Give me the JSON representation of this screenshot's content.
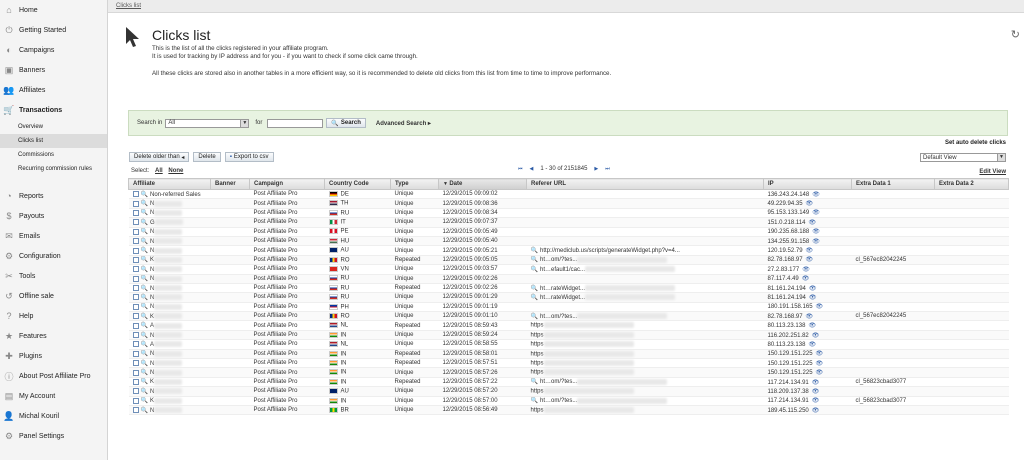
{
  "sidebar": {
    "items": [
      {
        "label": "Home",
        "icon": "home-icon",
        "glyph": "⌂"
      },
      {
        "label": "Getting Started",
        "icon": "power-icon",
        "glyph": "⏻"
      },
      {
        "label": "Campaigns",
        "icon": "campaigns-icon",
        "glyph": "◐"
      },
      {
        "label": "Banners",
        "icon": "banners-icon",
        "glyph": "▣"
      },
      {
        "label": "Affiliates",
        "icon": "affiliates-icon",
        "glyph": "👥"
      },
      {
        "label": "Transactions",
        "icon": "cart-icon",
        "glyph": "🛒"
      }
    ],
    "subitems": [
      {
        "label": "Overview"
      },
      {
        "label": "Clicks list"
      },
      {
        "label": "Commissions"
      },
      {
        "label": "Recurring commission rules"
      }
    ],
    "items2": [
      {
        "label": "Reports",
        "icon": "reports-icon",
        "glyph": "◔"
      },
      {
        "label": "Payouts",
        "icon": "payouts-icon",
        "glyph": "$"
      },
      {
        "label": "Emails",
        "icon": "email-icon",
        "glyph": "✉"
      },
      {
        "label": "Configuration",
        "icon": "gear-icon",
        "glyph": "⚙"
      },
      {
        "label": "Tools",
        "icon": "tools-icon",
        "glyph": "✂"
      },
      {
        "label": "Offline sale",
        "icon": "offline-sale-icon",
        "glyph": "↺"
      },
      {
        "label": "Help",
        "icon": "help-icon",
        "glyph": "?"
      },
      {
        "label": "Features",
        "icon": "star-icon",
        "glyph": "★"
      },
      {
        "label": "Plugins",
        "icon": "plugins-icon",
        "glyph": "✚"
      },
      {
        "label": "About Post Affiliate Pro",
        "icon": "info-icon",
        "glyph": "ⓘ"
      },
      {
        "label": "My Account",
        "icon": "account-icon",
        "glyph": "▤"
      },
      {
        "label": "Michal Kouril",
        "icon": "user-icon",
        "glyph": "👤"
      },
      {
        "label": "Panel Settings",
        "icon": "settings-icon",
        "glyph": "⚙"
      }
    ]
  },
  "breadcrumb": "Clicks list",
  "header": {
    "title": "Clicks list",
    "line1": "This is the list of all the clicks registered in your affiliate program.",
    "line2": "It is used for tracking by IP address and for you - if you want to check if some click came through.",
    "line3": "All these clicks are stored also in another tables in a more efficient way, so it is recommended to delete old clicks from this list from time to time to improve performance."
  },
  "search": {
    "label": "Search in",
    "scope": "All",
    "for_label": "for",
    "query": "",
    "button": "Search",
    "advanced": "Advanced Search"
  },
  "auto_delete": "Set auto delete clicks",
  "actions": {
    "delete_older": "Delete older than",
    "delete": "Delete",
    "export": "Export to csv"
  },
  "view": {
    "selected": "Default View",
    "edit": "Edit View"
  },
  "select": {
    "label": "Select:",
    "all": "All",
    "none": "None"
  },
  "pager": {
    "text": "1 - 30 of 2151845",
    "first": "⏮",
    "prev": "◀",
    "next": "▶",
    "last": "⏭"
  },
  "columns": [
    "Affiliate",
    "Banner",
    "Campaign",
    "Country Code",
    "Type",
    "Date",
    "Referer URL",
    "IP",
    "Extra Data 1",
    "Extra Data 2"
  ],
  "rows": [
    {
      "aff": "Non-referred Sales",
      "campaign": "Post Affiliate Pro",
      "cc": "DE",
      "flag": [
        "#000",
        "#d00",
        "#fc0"
      ],
      "type": "Unique",
      "date": "12/29/2015 09:09:02",
      "ref": "",
      "ip": "136.243.24.148",
      "x1": ""
    },
    {
      "aff": "N",
      "campaign": "Post Affiliate Pro",
      "cc": "TH",
      "flag": [
        "#a51931",
        "#f4f5f8",
        "#2d2a4a"
      ],
      "type": "Unique",
      "date": "12/29/2015 09:08:36",
      "ref": "",
      "ip": "49.229.94.35",
      "x1": ""
    },
    {
      "aff": "N",
      "campaign": "Post Affiliate Pro",
      "cc": "RU",
      "flag": [
        "#fff",
        "#0039a6",
        "#d52b1e"
      ],
      "type": "Unique",
      "date": "12/29/2015 09:08:34",
      "ref": "",
      "ip": "95.153.133.149",
      "x1": ""
    },
    {
      "aff": "G",
      "campaign": "Post Affiliate Pro",
      "cc": "IT",
      "flag": [
        "#009246",
        "#fff",
        "#ce2b37"
      ],
      "type": "Unique",
      "date": "12/29/2015 09:07:37",
      "ref": "",
      "ip": "151.0.218.114",
      "x1": ""
    },
    {
      "aff": "N",
      "campaign": "Post Affiliate Pro",
      "cc": "PE",
      "flag": [
        "#d91023",
        "#fff",
        "#d91023"
      ],
      "type": "Unique",
      "date": "12/29/2015 09:05:49",
      "ref": "",
      "ip": "190.235.68.188",
      "x1": ""
    },
    {
      "aff": "N",
      "campaign": "Post Affiliate Pro",
      "cc": "HU",
      "flag": [
        "#ce2939",
        "#fff",
        "#477050"
      ],
      "type": "Unique",
      "date": "12/29/2015 09:05:40",
      "ref": "",
      "ip": "134.255.91.158",
      "x1": ""
    },
    {
      "aff": "N",
      "campaign": "Post Affiliate Pro",
      "cc": "AU",
      "flag": [
        "#012169",
        "#012169",
        "#012169"
      ],
      "type": "Unique",
      "date": "12/29/2015 09:05:21",
      "ref": "http://mediclub.us/scripts/generateWidget.php?v=4...",
      "ip": "120.19.52.79",
      "x1": ""
    },
    {
      "aff": "K",
      "campaign": "Post Affiliate Pro",
      "cc": "RO",
      "flag": [
        "#002b7f",
        "#fcd116",
        "#ce1126"
      ],
      "type": "Repeated",
      "date": "12/29/2015 09:05:05",
      "ref": "ht…om/?tes...",
      "ip": "82.78.168.97",
      "x1": "cl_567ec82042245"
    },
    {
      "aff": "N",
      "campaign": "Post Affiliate Pro",
      "cc": "VN",
      "flag": [
        "#da251d",
        "#da251d",
        "#da251d"
      ],
      "type": "Unique",
      "date": "12/29/2015 09:03:57",
      "ref": "ht…efault1/cac...",
      "ip": "27.2.83.177",
      "x1": ""
    },
    {
      "aff": "N",
      "campaign": "Post Affiliate Pro",
      "cc": "RU",
      "flag": [
        "#fff",
        "#0039a6",
        "#d52b1e"
      ],
      "type": "Unique",
      "date": "12/29/2015 09:02:26",
      "ref": "",
      "ip": "87.117.4.49",
      "x1": ""
    },
    {
      "aff": "N",
      "campaign": "Post Affiliate Pro",
      "cc": "RU",
      "flag": [
        "#fff",
        "#0039a6",
        "#d52b1e"
      ],
      "type": "Repeated",
      "date": "12/29/2015 09:02:26",
      "ref": "ht…rateWidget...",
      "ip": "81.161.24.194",
      "x1": ""
    },
    {
      "aff": "N",
      "campaign": "Post Affiliate Pro",
      "cc": "RU",
      "flag": [
        "#fff",
        "#0039a6",
        "#d52b1e"
      ],
      "type": "Unique",
      "date": "12/29/2015 09:01:29",
      "ref": "ht…rateWidget...",
      "ip": "81.161.24.194",
      "x1": ""
    },
    {
      "aff": "N",
      "campaign": "Post Affiliate Pro",
      "cc": "PH",
      "flag": [
        "#0038a8",
        "#ce1126",
        "#fff"
      ],
      "type": "Unique",
      "date": "12/29/2015 09:01:19",
      "ref": "",
      "ip": "180.191.158.165",
      "x1": ""
    },
    {
      "aff": "K",
      "campaign": "Post Affiliate Pro",
      "cc": "RO",
      "flag": [
        "#002b7f",
        "#fcd116",
        "#ce1126"
      ],
      "type": "Unique",
      "date": "12/29/2015 09:01:10",
      "ref": "ht…om/?tes...",
      "ip": "82.78.168.97",
      "x1": "cl_567ec82042245"
    },
    {
      "aff": "A",
      "campaign": "Post Affiliate Pro",
      "cc": "NL",
      "flag": [
        "#ae1c28",
        "#fff",
        "#21468b"
      ],
      "type": "Repeated",
      "date": "12/29/2015 08:59:43",
      "ref": "https",
      "ip": "80.113.23.138",
      "x1": ""
    },
    {
      "aff": "N",
      "campaign": "Post Affiliate Pro",
      "cc": "IN",
      "flag": [
        "#ff9933",
        "#fff",
        "#138808"
      ],
      "type": "Unique",
      "date": "12/29/2015 08:59:24",
      "ref": "https",
      "ip": "116.202.251.82",
      "x1": ""
    },
    {
      "aff": "A",
      "campaign": "Post Affiliate Pro",
      "cc": "NL",
      "flag": [
        "#ae1c28",
        "#fff",
        "#21468b"
      ],
      "type": "Unique",
      "date": "12/29/2015 08:58:55",
      "ref": "https",
      "ip": "80.113.23.138",
      "x1": ""
    },
    {
      "aff": "N",
      "campaign": "Post Affiliate Pro",
      "cc": "IN",
      "flag": [
        "#ff9933",
        "#fff",
        "#138808"
      ],
      "type": "Repeated",
      "date": "12/29/2015 08:58:01",
      "ref": "https",
      "ip": "150.129.151.225",
      "x1": ""
    },
    {
      "aff": "N",
      "campaign": "Post Affiliate Pro",
      "cc": "IN",
      "flag": [
        "#ff9933",
        "#fff",
        "#138808"
      ],
      "type": "Repeated",
      "date": "12/29/2015 08:57:51",
      "ref": "https",
      "ip": "150.129.151.225",
      "x1": ""
    },
    {
      "aff": "N",
      "campaign": "Post Affiliate Pro",
      "cc": "IN",
      "flag": [
        "#ff9933",
        "#fff",
        "#138808"
      ],
      "type": "Unique",
      "date": "12/29/2015 08:57:26",
      "ref": "https",
      "ip": "150.129.151.225",
      "x1": ""
    },
    {
      "aff": "K",
      "campaign": "Post Affiliate Pro",
      "cc": "IN",
      "flag": [
        "#ff9933",
        "#fff",
        "#138808"
      ],
      "type": "Repeated",
      "date": "12/29/2015 08:57:22",
      "ref": "ht…om/?tes...",
      "ip": "117.214.134.91",
      "x1": "cl_56823cbad3077"
    },
    {
      "aff": "N",
      "campaign": "Post Affiliate Pro",
      "cc": "AU",
      "flag": [
        "#012169",
        "#012169",
        "#012169"
      ],
      "type": "Unique",
      "date": "12/29/2015 08:57:20",
      "ref": "https",
      "ip": "118.209.137.38",
      "x1": ""
    },
    {
      "aff": "K",
      "campaign": "Post Affiliate Pro",
      "cc": "IN",
      "flag": [
        "#ff9933",
        "#fff",
        "#138808"
      ],
      "type": "Unique",
      "date": "12/29/2015 08:57:00",
      "ref": "ht…om/?tes...",
      "ip": "117.214.134.91",
      "x1": "cl_56823cbad3077"
    },
    {
      "aff": "N",
      "campaign": "Post Affiliate Pro",
      "cc": "BR",
      "flag": [
        "#009c3b",
        "#ffdf00",
        "#009c3b"
      ],
      "type": "Unique",
      "date": "12/29/2015 08:56:49",
      "ref": "https",
      "ip": "189.45.115.250",
      "x1": ""
    }
  ]
}
